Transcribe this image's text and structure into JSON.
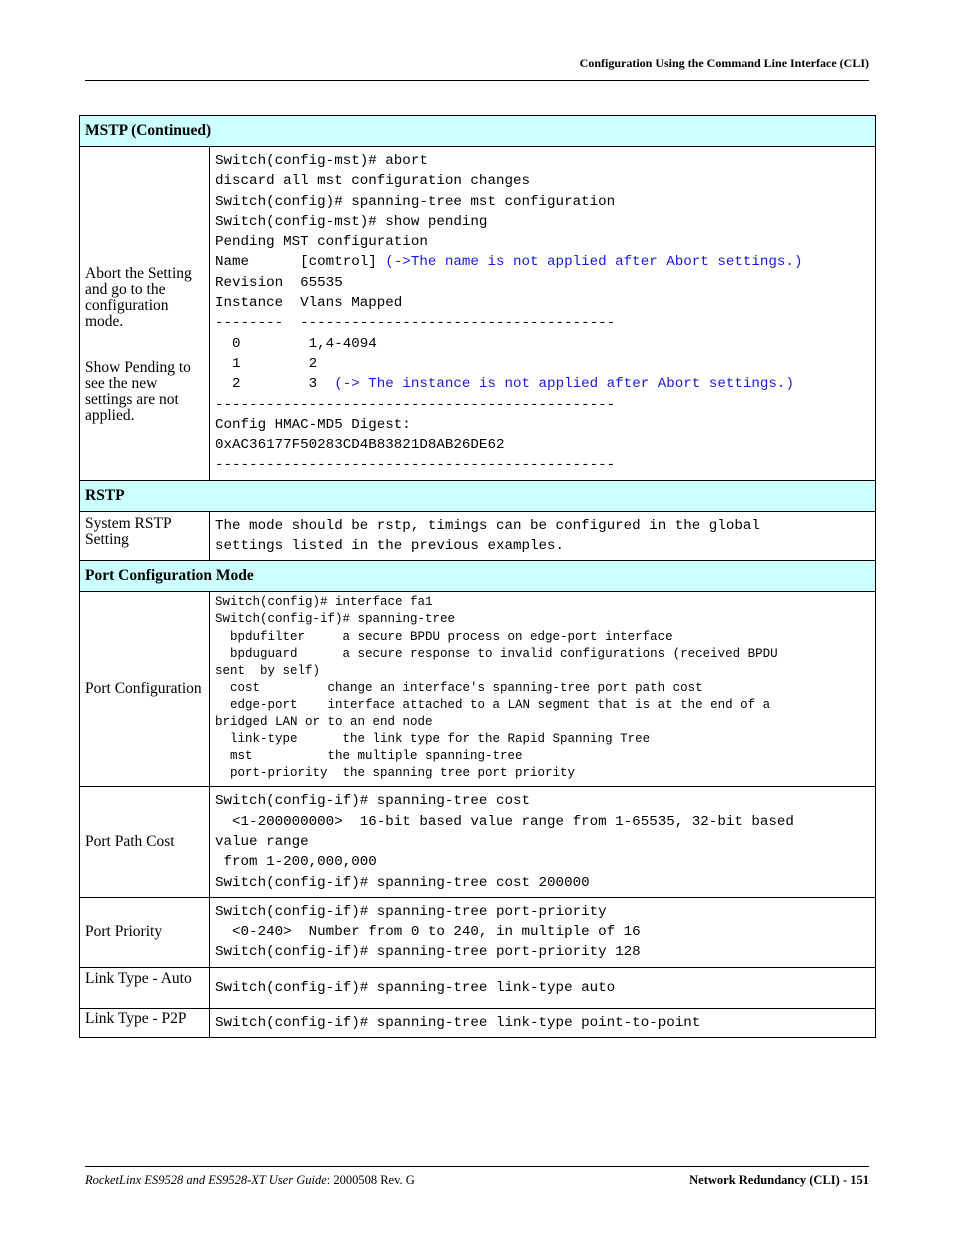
{
  "header": {
    "title": "Configuration Using the Command Line Interface (CLI)"
  },
  "sections": {
    "mstp": {
      "title": "MSTP (Continued)",
      "label_abort": "Abort the Setting and go to the configuration mode.",
      "label_show": "Show Pending to see the new settings are not applied.",
      "lines": [
        {
          "text": "Switch(config-mst)# abort",
          "note": ""
        },
        {
          "text": "discard all mst configuration changes",
          "note": ""
        },
        {
          "text": "Switch(config)# spanning-tree mst configuration",
          "note": ""
        },
        {
          "text": "Switch(config-mst)# show pending",
          "note": ""
        },
        {
          "text": "Pending MST configuration",
          "note": ""
        },
        {
          "text": "Name      [comtrol] ",
          "note": "(->The name is not applied after Abort settings.)"
        },
        {
          "text": "Revision  65535",
          "note": ""
        },
        {
          "text": "Instance  Vlans Mapped",
          "note": ""
        },
        {
          "text": "--------  -------------------------------------",
          "note": ""
        },
        {
          "text": "  0        1,4-4094",
          "note": ""
        },
        {
          "text": "  1        2",
          "note": ""
        },
        {
          "text": "  2        3  ",
          "note": "(-> The instance is not applied after Abort settings.)"
        },
        {
          "text": "-----------------------------------------------",
          "note": ""
        },
        {
          "text": "Config HMAC-MD5 Digest:",
          "note": ""
        },
        {
          "text": "0xAC36177F50283CD4B83821D8AB26DE62",
          "note": ""
        },
        {
          "text": "-----------------------------------------------",
          "note": ""
        }
      ]
    },
    "rstp": {
      "title": "RSTP",
      "rows": [
        {
          "label": "System RSTP Setting",
          "lines": [
            "The mode should be rstp, timings can be configured in the global",
            "settings listed in the previous examples."
          ]
        }
      ]
    },
    "port_config": {
      "title": "Port Configuration Mode",
      "rows": [
        {
          "label": "Port Configuration",
          "lines": [
            "Switch(config)# interface fa1",
            "Switch(config-if)# spanning-tree",
            "  bpdufilter     a secure BPDU process on edge-port interface",
            "  bpduguard      a secure response to invalid configurations (received BPDU",
            "sent  by self)",
            "  cost         change an interface's spanning-tree port path cost",
            "  edge-port    interface attached to a LAN segment that is at the end of a",
            "bridged LAN or to an end node",
            "  link-type      the link type for the Rapid Spanning Tree",
            "  mst          the multiple spanning-tree",
            "  port-priority  the spanning tree port priority"
          ]
        },
        {
          "label": "Port Path Cost",
          "lines": [
            "Switch(config-if)# spanning-tree cost",
            "  <1-200000000>  16-bit based value range from 1-65535, 32-bit based",
            "value range",
            " from 1-200,000,000",
            "Switch(config-if)# spanning-tree cost 200000"
          ]
        },
        {
          "label": "Port Priority",
          "lines": [
            "Switch(config-if)# spanning-tree port-priority",
            "  <0-240>  Number from 0 to 240, in multiple of 16",
            "Switch(config-if)# spanning-tree port-priority 128"
          ]
        },
        {
          "label": "Link Type - Auto",
          "lines": [
            "Switch(config-if)# spanning-tree link-type auto"
          ]
        },
        {
          "label": "Link Type - P2P",
          "lines": [
            "Switch(config-if)# spanning-tree link-type point-to-point"
          ]
        }
      ]
    }
  },
  "footer": {
    "guide_title": "RocketLinx ES9528 and ES9528-XT User Guide",
    "doc_number": ": 2000508 Rev. G",
    "page_label": "Network Redundancy (CLI) - 151"
  },
  "colors": {
    "section_header_bg": "#ccffff",
    "annotation_blue": "#1a1adb"
  }
}
